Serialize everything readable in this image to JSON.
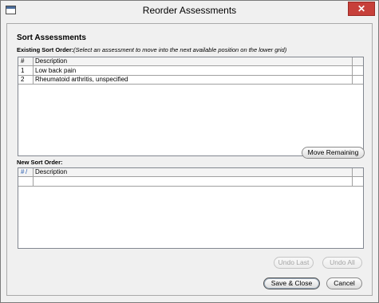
{
  "window": {
    "title": "Reorder Assessments",
    "close_glyph": "✕"
  },
  "sort_section": {
    "title": "Sort Assessments",
    "existing_label": "Existing Sort Order:",
    "existing_hint": "(Select an assessment to move into the next available position on the lower grid)",
    "new_label": "New Sort Order:"
  },
  "existing_grid": {
    "columns": [
      "#",
      "Description"
    ],
    "rows": [
      {
        "num": "1",
        "description": "Low back pain"
      },
      {
        "num": "2",
        "description": "Rheumatoid arthritis, unspecified"
      }
    ]
  },
  "new_grid": {
    "columns": [
      "#",
      "/",
      "Description"
    ]
  },
  "buttons": {
    "move_remaining": "Move Remaining",
    "undo_last": "Undo Last",
    "undo_all": "Undo All",
    "save_close": "Save & Close",
    "cancel": "Cancel"
  }
}
